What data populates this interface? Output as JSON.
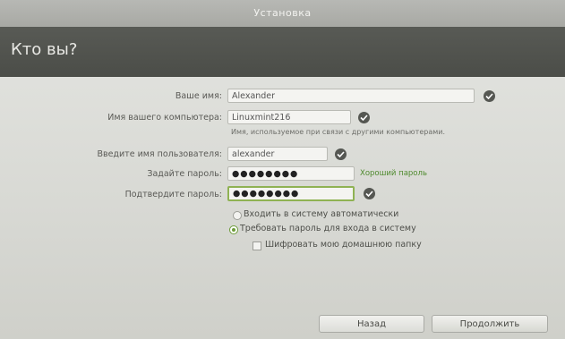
{
  "window": {
    "title": "Установка"
  },
  "header": {
    "title": "Кто вы?"
  },
  "form": {
    "name": {
      "label": "Ваше имя:",
      "value": "Alexander"
    },
    "computer": {
      "label": "Имя вашего компьютера:",
      "value": "Linuxmint216",
      "hint": "Имя, используемое при связи с другими компьютерами."
    },
    "username": {
      "label": "Введите имя пользователя:",
      "value": "alexander"
    },
    "password": {
      "label": "Задайте пароль:",
      "value": "●●●●●●●●",
      "strength": "Хороший пароль"
    },
    "confirm": {
      "label": "Подтвердите пароль:",
      "value": "●●●●●●●●"
    }
  },
  "options": {
    "autologin": {
      "label": "Входить в систему автоматически",
      "selected": false
    },
    "require_password": {
      "label": "Требовать пароль для входа в систему",
      "selected": true
    },
    "encrypt_home": {
      "label": "Шифровать мою домашнюю папку",
      "checked": false
    }
  },
  "buttons": {
    "back": "Назад",
    "continue": "Продолжить"
  },
  "colors": {
    "header_bg": "#4f514c",
    "accent": "#8fb253",
    "check_bg": "#555752"
  }
}
